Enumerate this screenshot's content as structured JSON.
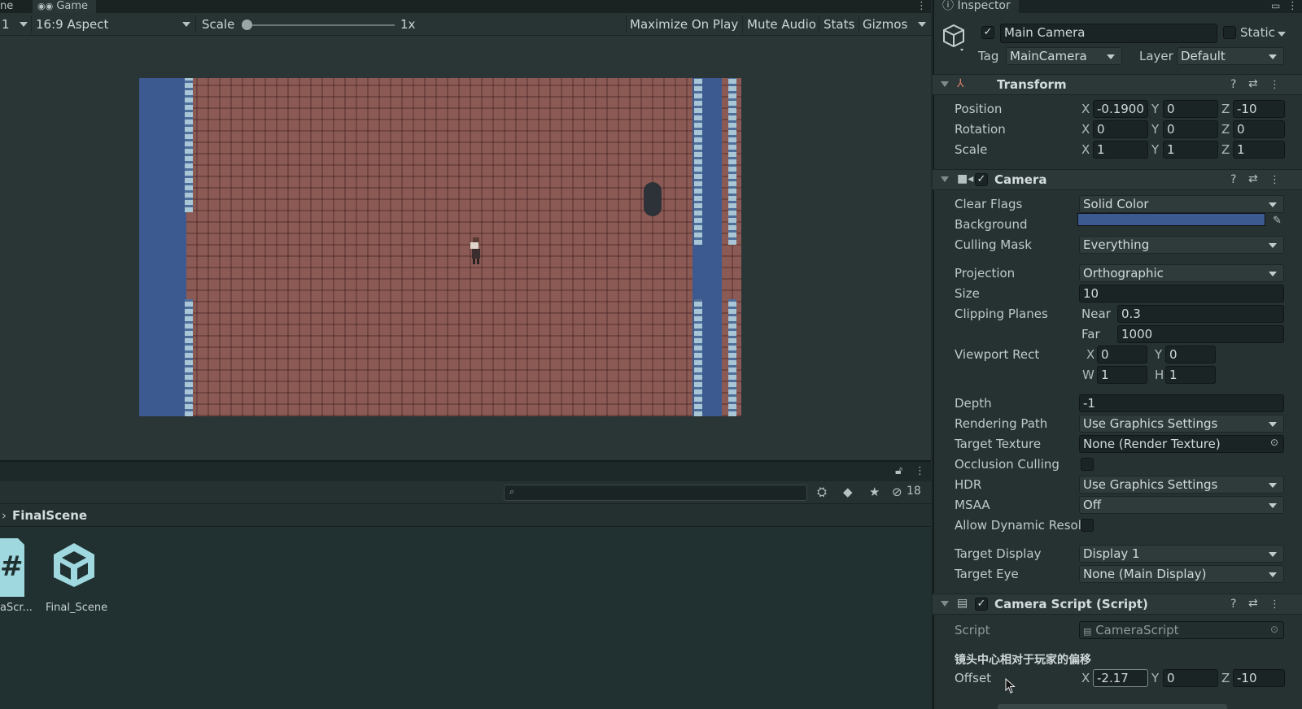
{
  "game": {
    "tabs": {
      "prev_tab_fragment": "ne",
      "game_tab": "Game"
    },
    "toolbar": {
      "display_fragment": "1",
      "aspect": "16:9 Aspect",
      "scale_label": "Scale",
      "scale_value": "1x",
      "maximize_on_play": "Maximize On Play",
      "mute_audio": "Mute Audio",
      "stats": "Stats",
      "gizmos": "Gizmos"
    },
    "scene_colors": {
      "floor": "#8c5a55",
      "water": "#3c5a8f",
      "pillar": "#2d3138"
    }
  },
  "project": {
    "hidden_count": "18",
    "breadcrumb": "FinalScene",
    "assets": [
      {
        "label": "aScr...",
        "icon": "csharp-script-icon"
      },
      {
        "label": "Final_Scene",
        "icon": "unity-scene-icon"
      }
    ]
  },
  "inspector": {
    "tab_title": "Inspector",
    "object_name": "Main Camera",
    "static_label": "Static",
    "tag_label": "Tag",
    "tag_value": "MainCamera",
    "layer_label": "Layer",
    "layer_value": "Default",
    "transform": {
      "title": "Transform",
      "position": {
        "label": "Position",
        "x": "-0.1900",
        "y": "0",
        "z": "-10"
      },
      "rotation": {
        "label": "Rotation",
        "x": "0",
        "y": "0",
        "z": "0"
      },
      "scale": {
        "label": "Scale",
        "x": "1",
        "y": "1",
        "z": "1"
      }
    },
    "camera": {
      "title": "Camera",
      "clear_flags_label": "Clear Flags",
      "clear_flags": "Solid Color",
      "background_label": "Background",
      "background_color": "#3c5a8f",
      "culling_mask_label": "Culling Mask",
      "culling_mask": "Everything",
      "projection_label": "Projection",
      "projection": "Orthographic",
      "size_label": "Size",
      "size": "10",
      "clipping_label": "Clipping Planes",
      "near_label": "Near",
      "near": "0.3",
      "far_label": "Far",
      "far": "1000",
      "viewport_label": "Viewport Rect",
      "vx": "0",
      "vy": "0",
      "vw": "1",
      "vh": "1",
      "depth_label": "Depth",
      "depth": "-1",
      "rendering_path_label": "Rendering Path",
      "rendering_path": "Use Graphics Settings",
      "target_texture_label": "Target Texture",
      "target_texture": "None (Render Texture)",
      "occlusion_label": "Occlusion Culling",
      "hdr_label": "HDR",
      "hdr": "Use Graphics Settings",
      "msaa_label": "MSAA",
      "msaa": "Off",
      "dynamic_res_label": "Allow Dynamic Resol",
      "target_display_label": "Target Display",
      "target_display": "Display 1",
      "target_eye_label": "Target Eye",
      "target_eye": "None (Main Display)"
    },
    "camera_script": {
      "title": "Camera Script (Script)",
      "script_label": "Script",
      "script_value": "CameraScript",
      "header": "镜头中心相对于玩家的偏移",
      "offset_label": "Offset",
      "x": "-2.17",
      "y": "0",
      "z": "-10"
    }
  }
}
